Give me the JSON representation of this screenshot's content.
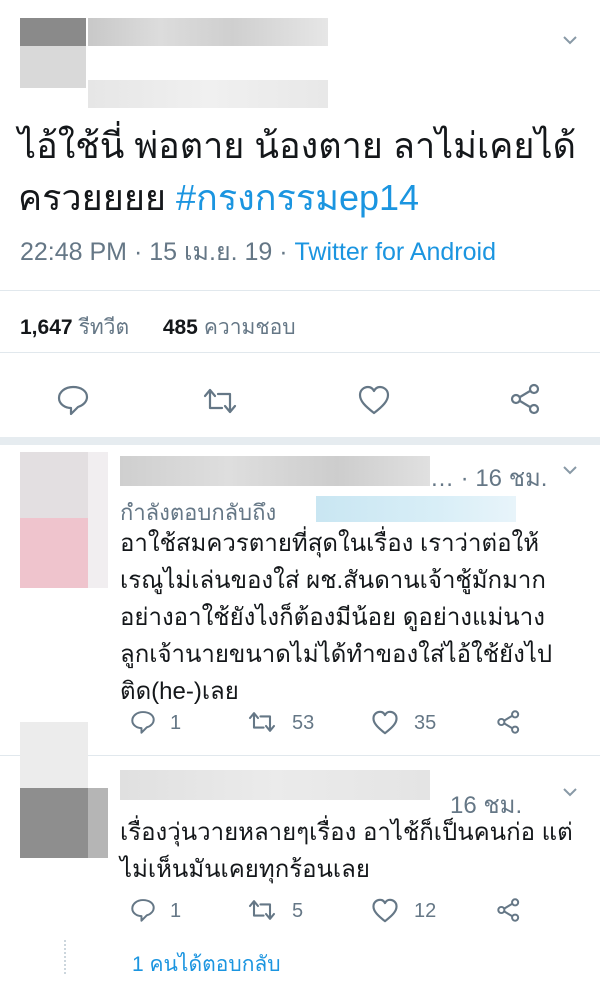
{
  "tweet": {
    "text_line1": "ไอ้ใช้นี่ พ่อตาย น้องตาย ลาไม่เคยได้",
    "text_line2_prefix": "ครวยยยย ",
    "hashtag": "#กรงกรรมep14",
    "time": "22:48 PM · 15 เม.ย. 19 · ",
    "source": "Twitter for Android",
    "retweets_count": "1,647",
    "retweets_label": "รีทวีต",
    "likes_count": "485",
    "likes_label": "ความชอบ"
  },
  "replies": [
    {
      "time": "… · 16 ชม.",
      "replying_to_label": "กำลังตอบกลับถึง",
      "text_lines": [
        "อาใช้สมควรตายที่สุดในเรื่อง เราว่าต่อให้",
        "เรณูไม่เล่นของใส่ ผช.สันดานเจ้าชู้มักมาก",
        "อย่างอาใช้ยังไงก็ต้องมีน้อย ดูอย่างแม่นาง",
        "ลูกเจ้านายขนาดไม่ได้ทำของใส่ไอ้ใช้ยังไป",
        "ติด(he-)เลย"
      ],
      "reply_count": "1",
      "retweet_count": "53",
      "like_count": "35"
    },
    {
      "time": "16 ชม.",
      "text_lines": [
        "เรื่องวุ่นวายหลายๆเรื่อง อาไช้ก็เป็นคนก่อ แต่",
        "ไม่เห็นมันเคยทุกร้อนเลย"
      ],
      "reply_count": "1",
      "retweet_count": "5",
      "like_count": "12"
    }
  ],
  "more_replies_label": "1 คนได้ตอบกลับ",
  "icons": [
    "chevron-down-icon",
    "reply-icon",
    "retweet-icon",
    "like-icon",
    "share-icon"
  ],
  "colors": {
    "accent": "#1b95e0",
    "muted": "#657786",
    "text": "#14171a",
    "divider": "#e1e8ed"
  }
}
